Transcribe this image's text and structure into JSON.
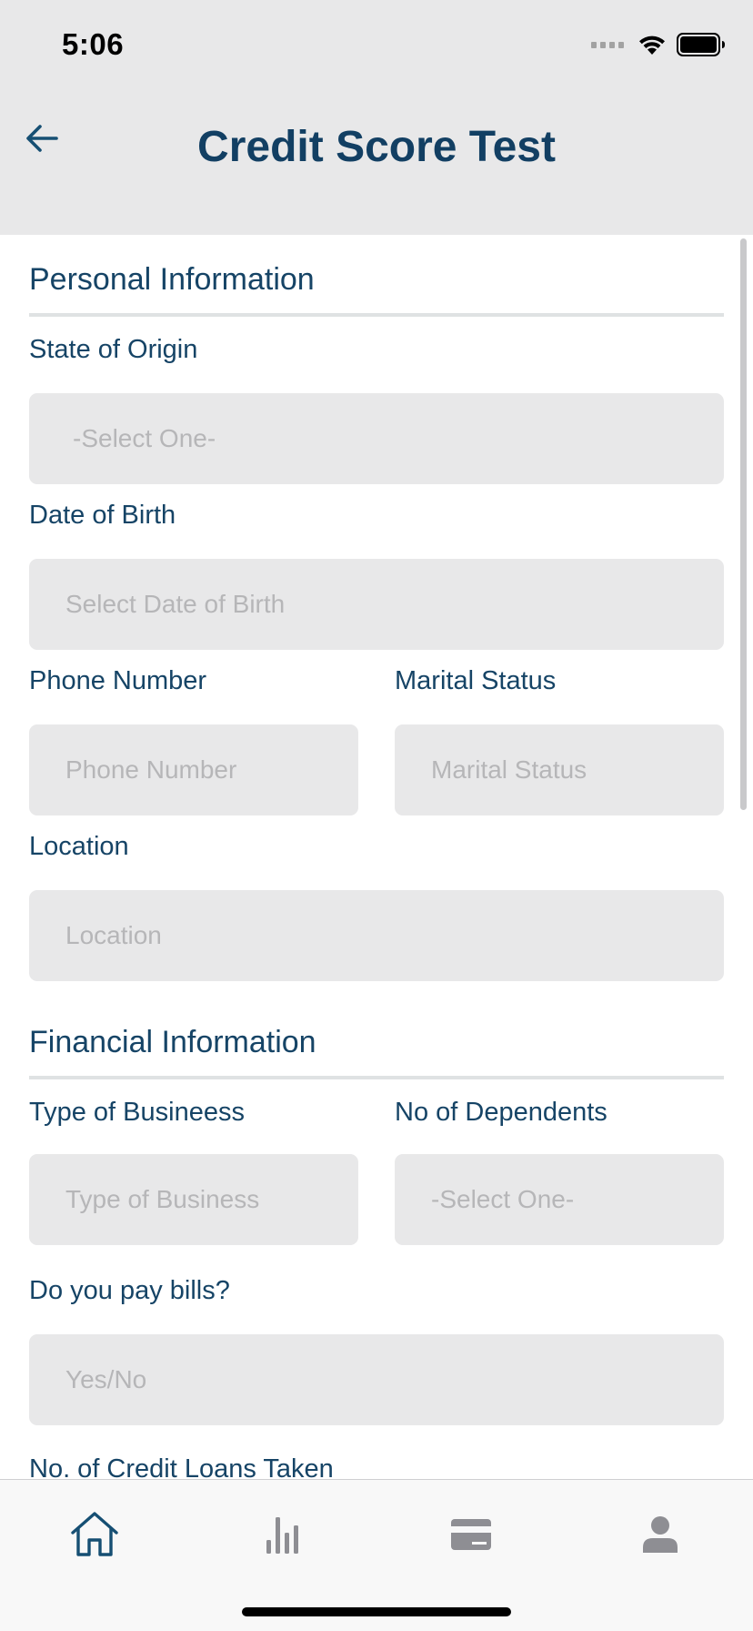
{
  "status_bar": {
    "time": "5:06"
  },
  "header": {
    "title": "Credit Score Test"
  },
  "personal_section": {
    "title": "Personal Information",
    "state_of_origin": {
      "label": "State of Origin",
      "placeholder": "-Select One-"
    },
    "date_of_birth": {
      "label": "Date of Birth",
      "placeholder": "Select Date of Birth"
    },
    "phone_number": {
      "label": "Phone Number",
      "placeholder": "Phone Number"
    },
    "marital_status": {
      "label": "Marital Status",
      "placeholder": "Marital Status"
    },
    "location": {
      "label": "Location",
      "placeholder": "Location"
    }
  },
  "financial_section": {
    "title": "Financial Information",
    "type_of_business": {
      "label": "Type of Busineess",
      "placeholder": "Type of Business"
    },
    "no_of_dependents": {
      "label": "No of Dependents",
      "placeholder": "-Select One-"
    },
    "pay_bills": {
      "label": "Do you pay bills?",
      "placeholder": "Yes/No"
    },
    "credit_loans": {
      "label": "No. of Credit Loans Taken"
    }
  },
  "tab_bar": {
    "tabs": [
      {
        "icon": "home-icon",
        "active": true
      },
      {
        "icon": "bar-chart-icon",
        "active": false
      },
      {
        "icon": "credit-card-icon",
        "active": false
      },
      {
        "icon": "person-icon",
        "active": false
      }
    ]
  },
  "colors": {
    "primary": "#123f63",
    "header_bg": "#e8e8e9",
    "field_bg": "#e8e8e9",
    "placeholder": "#b6b6b8",
    "inactive_icon": "#8e8e93"
  }
}
